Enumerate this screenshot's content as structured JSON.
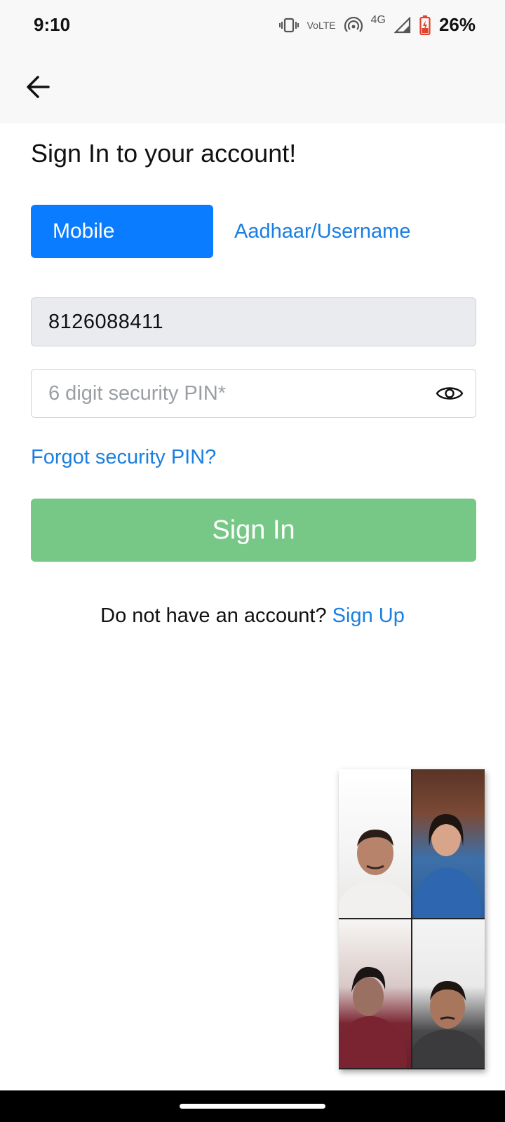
{
  "status_bar": {
    "time": "9:10",
    "volte_top": "Vo",
    "volte_bottom": "LTE",
    "network": "4G",
    "battery": "26%"
  },
  "header": {
    "back_icon": "arrow-left-icon"
  },
  "title": "Sign In to your account!",
  "tabs": [
    {
      "label": "Mobile",
      "active": true
    },
    {
      "label": "Aadhaar/Username",
      "active": false
    }
  ],
  "form": {
    "phone_value": "8126088411",
    "pin_placeholder": "6 digit security PIN*",
    "pin_toggle_icon": "eye-icon",
    "forgot_link": "Forgot security PIN?",
    "signin_button": "Sign In"
  },
  "signup": {
    "prompt": "Do not have an account?",
    "link": "Sign Up"
  },
  "colors": {
    "accent": "#0a7cff",
    "link": "#1a7fe0",
    "signin_button": "#77c886",
    "field_disabled_bg": "#e9ebee"
  },
  "video_call": {
    "participant_count": 4
  }
}
